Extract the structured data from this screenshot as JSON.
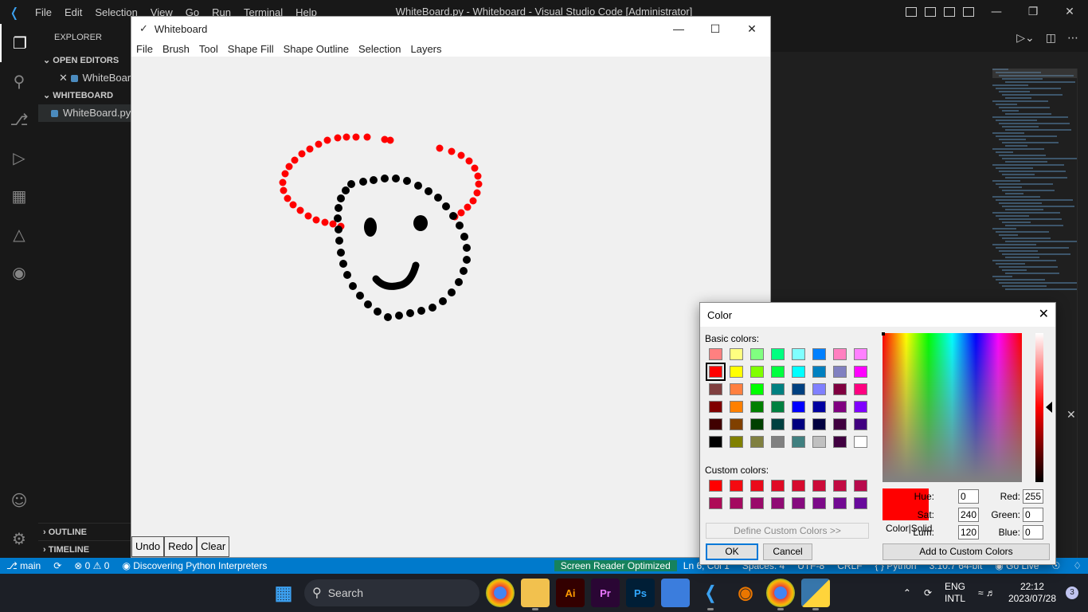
{
  "vscode": {
    "menu": [
      "File",
      "Edit",
      "Selection",
      "View",
      "Go",
      "Run",
      "Terminal",
      "Help"
    ],
    "window_title": "WhiteBoard.py - Whiteboard - Visual Studio Code [Administrator]",
    "explorer_title": "EXPLORER",
    "open_editors_header": "OPEN EDITORS",
    "open_editor_item": "WhiteBoard.py",
    "folder_header": "WHITEBOARD",
    "file_item": "WhiteBoard.py",
    "outline_header": "OUTLINE",
    "timeline_header": "TIMELINE",
    "accent": "#007acc"
  },
  "statusbar": {
    "branch": "main",
    "errors": "0",
    "warnings": "0",
    "discovering": "Discovering Python Interpreters",
    "screen_reader": "Screen Reader Optimized",
    "position": "Ln 6, Col 1",
    "spaces": "Spaces: 4",
    "encoding": "UTF-8",
    "eol": "CRLF",
    "language": "Python",
    "interpreter": "3.10.7 64-bit",
    "go_live": "Go Live"
  },
  "whiteboard": {
    "title": "Whiteboard",
    "menu": [
      "File",
      "Brush",
      "Tool",
      "Shape Fill",
      "Shape Outline",
      "Selection",
      "Layers"
    ],
    "buttons": [
      "Undo",
      "Redo",
      "Clear"
    ]
  },
  "color_dialog": {
    "title": "Color",
    "basic_colors_label": "Basic colors:",
    "custom_colors_label": "Custom colors:",
    "define_custom": "Define Custom Colors >>",
    "ok": "OK",
    "cancel": "Cancel",
    "add_custom": "Add to Custom Colors",
    "color_solid": "Color|Solid",
    "hue_label": "Hue:",
    "hue": "0",
    "sat_label": "Sat:",
    "sat": "240",
    "lum_label": "Lum:",
    "lum": "120",
    "red_label": "Red:",
    "red": "255",
    "green_label": "Green:",
    "green": "0",
    "blue_label": "Blue:",
    "blue": "0",
    "basic_colors": [
      [
        "#ff8080",
        "#ffff80",
        "#80ff80",
        "#00ff80",
        "#80ffff",
        "#0080ff",
        "#ff80c0",
        "#ff80ff"
      ],
      [
        "#ff0000",
        "#ffff00",
        "#80ff00",
        "#00ff40",
        "#00ffff",
        "#0080c0",
        "#8080c0",
        "#ff00ff"
      ],
      [
        "#804040",
        "#ff8040",
        "#00ff00",
        "#008080",
        "#004080",
        "#8080ff",
        "#800040",
        "#ff0080"
      ],
      [
        "#800000",
        "#ff8000",
        "#008000",
        "#008040",
        "#0000ff",
        "#0000a0",
        "#800080",
        "#8000ff"
      ],
      [
        "#400000",
        "#804000",
        "#004000",
        "#004040",
        "#000080",
        "#000040",
        "#400040",
        "#400080"
      ],
      [
        "#000000",
        "#808000",
        "#808040",
        "#808080",
        "#408080",
        "#c0c0c0",
        "#400040",
        "#ffffff"
      ]
    ],
    "custom_colors": [
      [
        "#ff0000",
        "#f40a10",
        "#ea0a1a",
        "#e00a24",
        "#d60a2e",
        "#cc0a38",
        "#c20a42",
        "#b80a4c"
      ],
      [
        "#ae0a56",
        "#a40a60",
        "#9a0a6a",
        "#900a74",
        "#860a7e",
        "#7c0a88",
        "#720a92",
        "#680a9c"
      ]
    ],
    "selected_basic": [
      1,
      0
    ]
  },
  "taskbar": {
    "search": "Search",
    "apps": [
      "windows-start",
      "chrome",
      "file-explorer",
      "illustrator",
      "premiere",
      "photoshop",
      "notepad",
      "vscode",
      "blender",
      "chrome-profile",
      "python"
    ],
    "app_labels": {
      "illustrator": "Ai",
      "premiere": "Pr",
      "photoshop": "Ps"
    },
    "lang_top": "ENG",
    "lang_bottom": "INTL",
    "time": "22:12",
    "date": "2023/07/28",
    "notifications": "3"
  }
}
